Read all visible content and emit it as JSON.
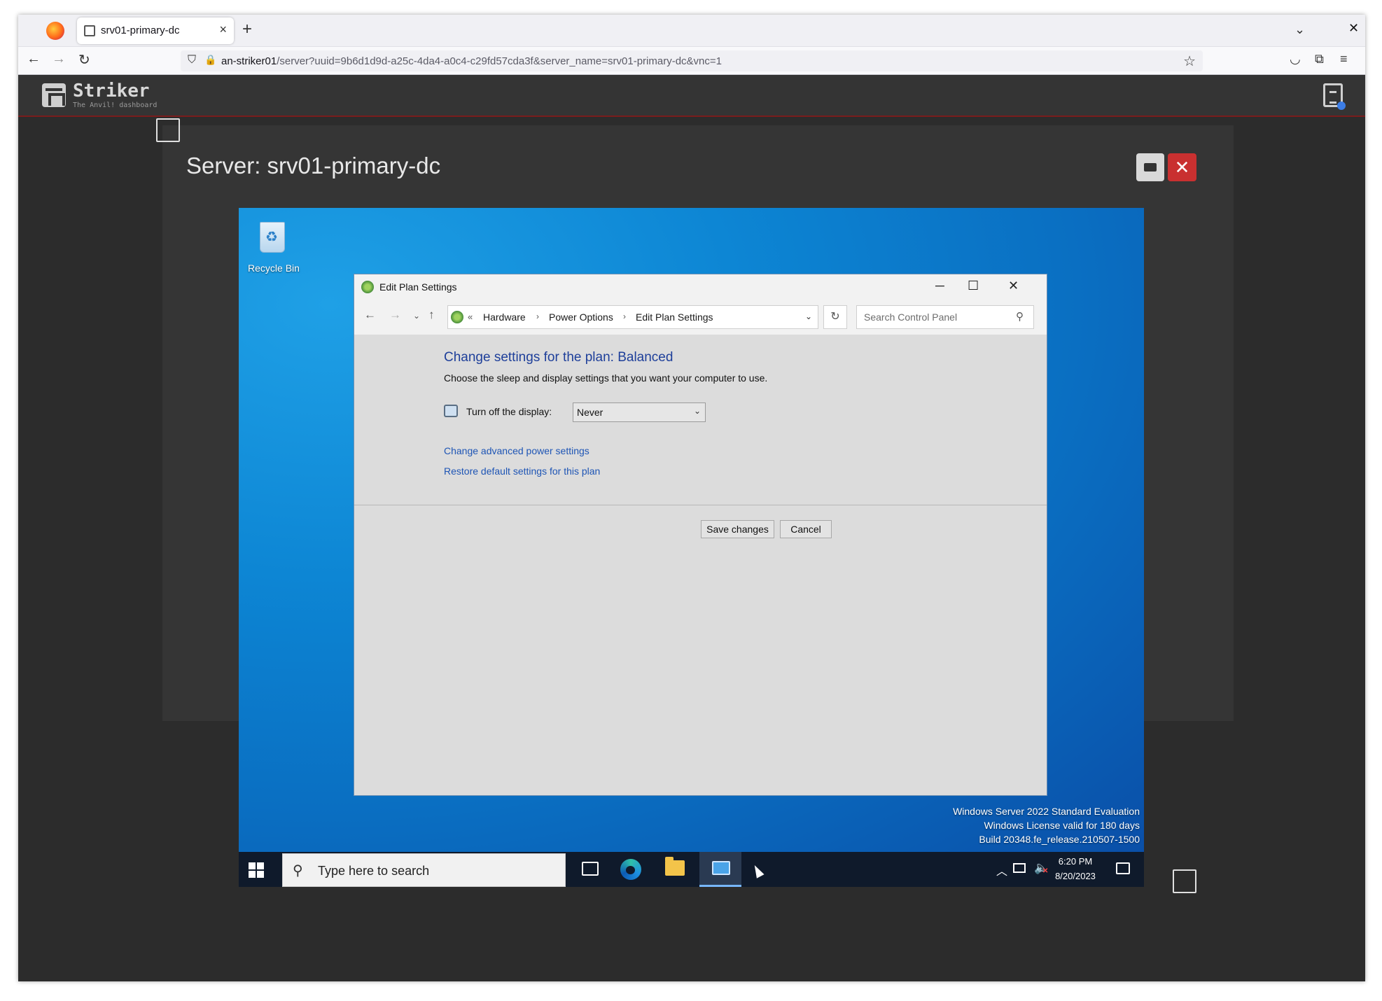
{
  "browser": {
    "tab_title": "srv01-primary-dc",
    "url_host": "an-striker01",
    "url_path": "/server?uuid=9b6d1d9d-a25c-4da4-a0c4-c29fd57cda3f&server_name=srv01-primary-dc&vnc=1"
  },
  "app": {
    "name": "Striker",
    "tagline": "The Anvil! dashboard"
  },
  "page": {
    "title": "Server: srv01-primary-dc"
  },
  "desktop": {
    "recycle_bin_label": "Recycle Bin",
    "watermark": {
      "line1": "Windows Server 2022 Standard Evaluation",
      "line2": "Windows License valid for 180 days",
      "line3": "Build 20348.fe_release.210507-1500"
    }
  },
  "control_panel": {
    "window_title": "Edit Plan Settings",
    "breadcrumb_prefix": "«",
    "breadcrumbs": [
      "Hardware",
      "Power Options",
      "Edit Plan Settings"
    ],
    "search_placeholder": "Search Control Panel",
    "heading": "Change settings for the plan: Balanced",
    "description": "Choose the sleep and display settings that you want your computer to use.",
    "display_label": "Turn off the display:",
    "display_value": "Never",
    "link_advanced": "Change advanced power settings",
    "link_restore": "Restore default settings for this plan",
    "save_label": "Save changes",
    "cancel_label": "Cancel"
  },
  "taskbar": {
    "search_text": "Type here to search",
    "time": "6:20 PM",
    "date": "8/20/2023"
  }
}
